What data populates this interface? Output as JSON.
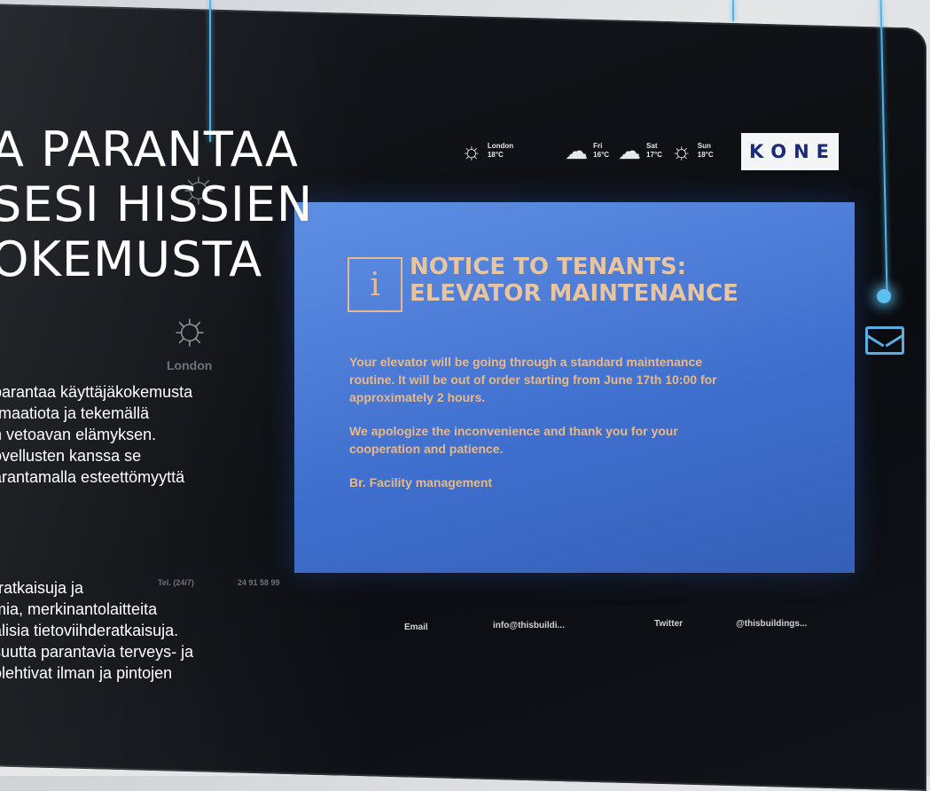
{
  "overlay": {
    "headline": [
      "A PARANTAA",
      "SESI HISSIEN",
      "OKEMUSTA"
    ],
    "paragraph1": [
      "parantaa käyttäjäkokemusta",
      "rmaatiota ja tekemällä",
      "n vetoavan elämyksen.",
      "ovellusten kanssa se",
      "arantamalla esteettömyyttä"
    ],
    "paragraph2": [
      "-ratkaisuja ja",
      "mia, merkinantolaitteita",
      "alisia tietoviihderatkaisuja.",
      "suutta parantavia terveys- ja",
      "olehtivat ilman ja pintojen"
    ]
  },
  "weather": {
    "current": {
      "city": "London",
      "temp": "18°C"
    },
    "forecast": [
      {
        "day": "Fri",
        "temp": "16°C",
        "icon": "cloud-icon"
      },
      {
        "day": "Sat",
        "temp": "17°C",
        "icon": "cloud-icon"
      },
      {
        "day": "Sun",
        "temp": "18°C",
        "icon": "sun-icon"
      }
    ]
  },
  "brand": {
    "logo": [
      "K",
      "O",
      "N",
      "E"
    ]
  },
  "notice": {
    "title_line1": "NOTICE TO TENANTS:",
    "title_line2": "ELEVATOR MAINTENANCE",
    "body1": "Your elevator will be going through a standard maintenance routine. It will be out of order starting from June 17th 10:00 for approximately 2 hours.",
    "body2": "We apologize the inconvenience and thank you for your cooperation and patience.",
    "signature": "Br. Facility management"
  },
  "contacts": {
    "email_label": "Email",
    "email_value": "info@thisbuildi...",
    "twitter_label": "Twitter",
    "twitter_value": "@thisbuildings..."
  },
  "ghost": {
    "city": "London",
    "tel_label": "Tel. (24/7)",
    "tel_value": "24 91 58 99"
  },
  "colors": {
    "panel_blue": "#4a7ad6",
    "notice_text": "#e8b98d",
    "accent_line": "#4fb3e8",
    "kone_blue": "#1b2a78"
  }
}
